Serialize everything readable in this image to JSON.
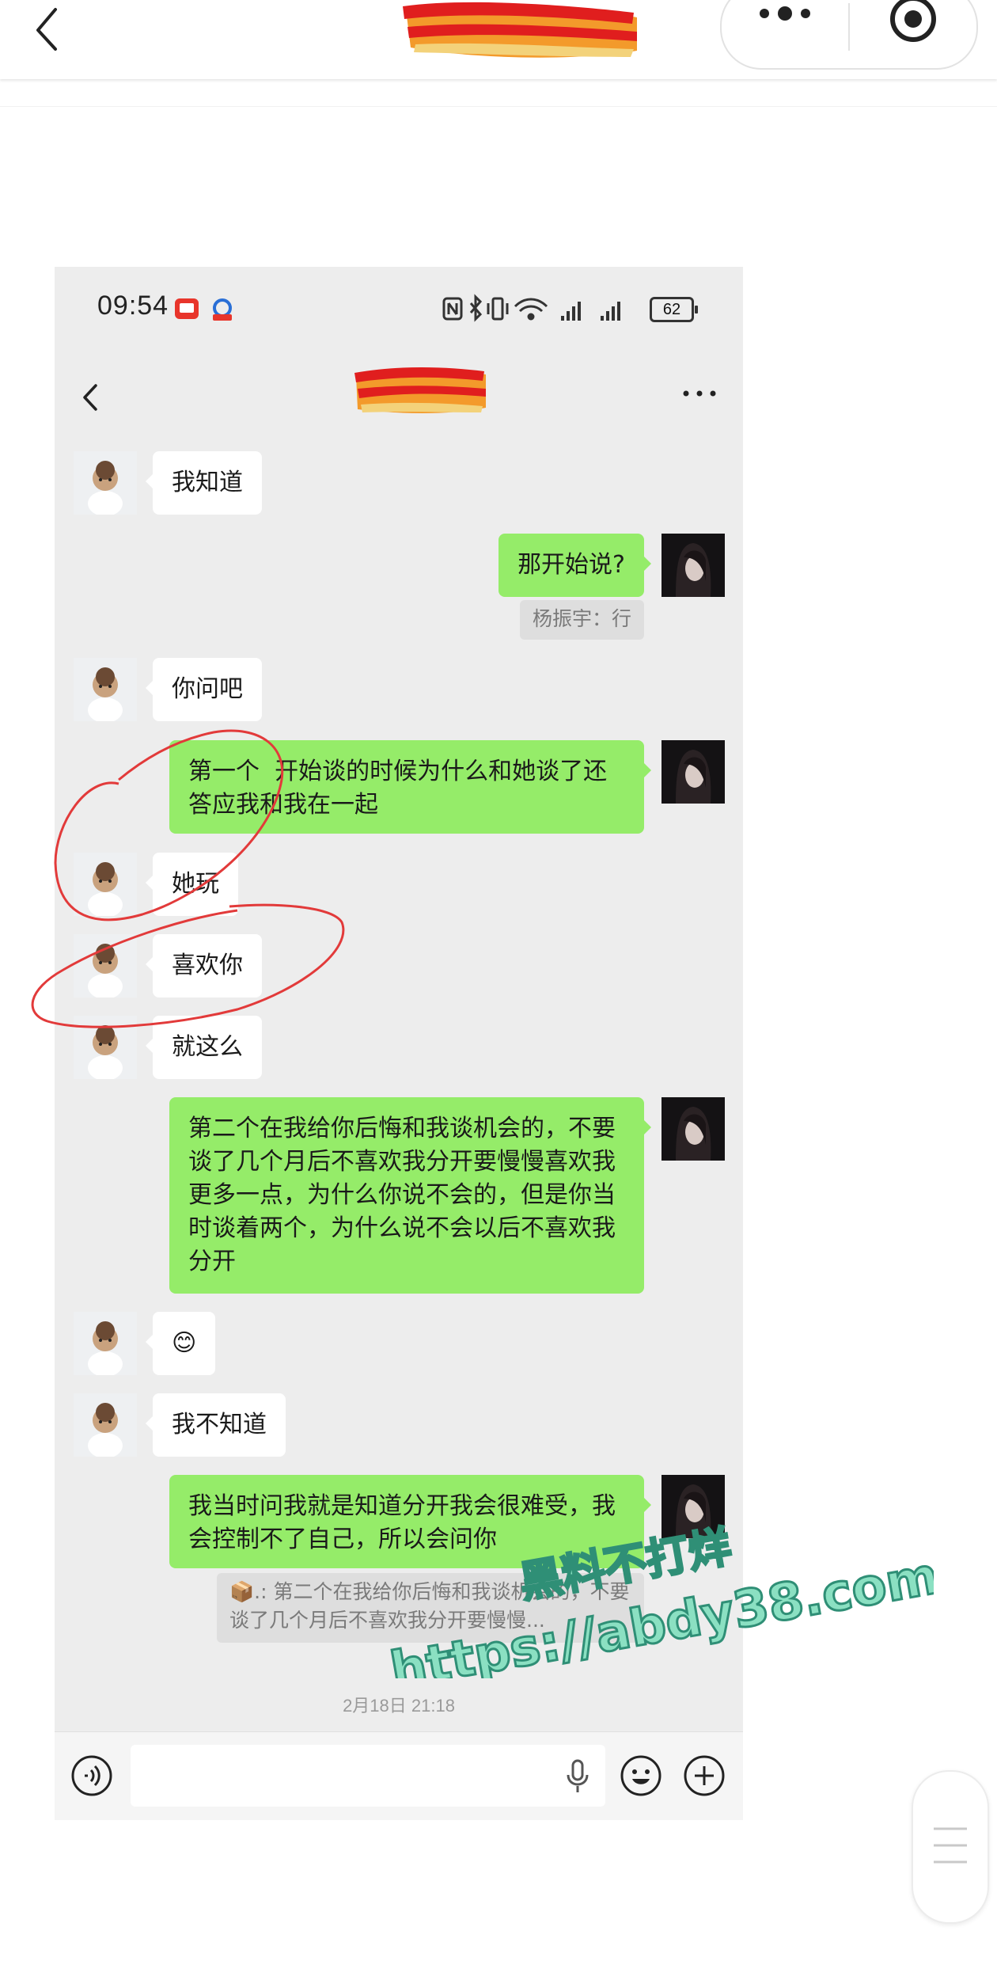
{
  "status_bar": {
    "time": "09:54",
    "battery": "62"
  },
  "messages": [
    {
      "side": "left",
      "text": "我知道"
    },
    {
      "side": "right",
      "text": "那开始说?"
    },
    {
      "side": "right-quote",
      "text": "杨振宇：行"
    },
    {
      "side": "left",
      "text": "你问吧"
    },
    {
      "side": "right",
      "text": "第一个  开始谈的时候为什么和她谈了还答应我和我在一起"
    },
    {
      "side": "left",
      "text": "她玩"
    },
    {
      "side": "left",
      "text": "喜欢你"
    },
    {
      "side": "left",
      "text": "就这么"
    },
    {
      "side": "right",
      "text": "第二个在我给你后悔和我谈机会的，不要谈了几个月后不喜欢我分开要慢慢喜欢我更多一点，为什么你说不会的，但是你当时谈着两个，为什么说不会以后不喜欢我分开"
    },
    {
      "side": "left",
      "text": "😊"
    },
    {
      "side": "left",
      "text": "我不知道"
    },
    {
      "side": "right",
      "text": "我当时问我就是知道分开我会很难受，我会控制不了自己，所以会问你"
    },
    {
      "side": "right-quote",
      "text": "📦.: 第二个在我给你后悔和我谈机会的，不要谈了几个月后不喜欢我分开要慢慢..."
    }
  ],
  "timestamp": "2月18日 21:18",
  "watermark": {
    "line1": "黑料不打烊",
    "line2": "https://abdy38.com"
  },
  "colors": {
    "bubble_right": "#95ec69",
    "bubble_left": "#ffffff",
    "chat_bg": "#ededed",
    "annotation": "#e23a3a"
  },
  "icons": [
    "back-icon",
    "more-icon",
    "target-icon",
    "voice-icon",
    "mic-icon",
    "emoji-icon",
    "plus-icon",
    "nfc-icon",
    "bluetooth-icon",
    "vibrate-icon",
    "wifi-icon",
    "signal-icon",
    "battery-icon"
  ]
}
